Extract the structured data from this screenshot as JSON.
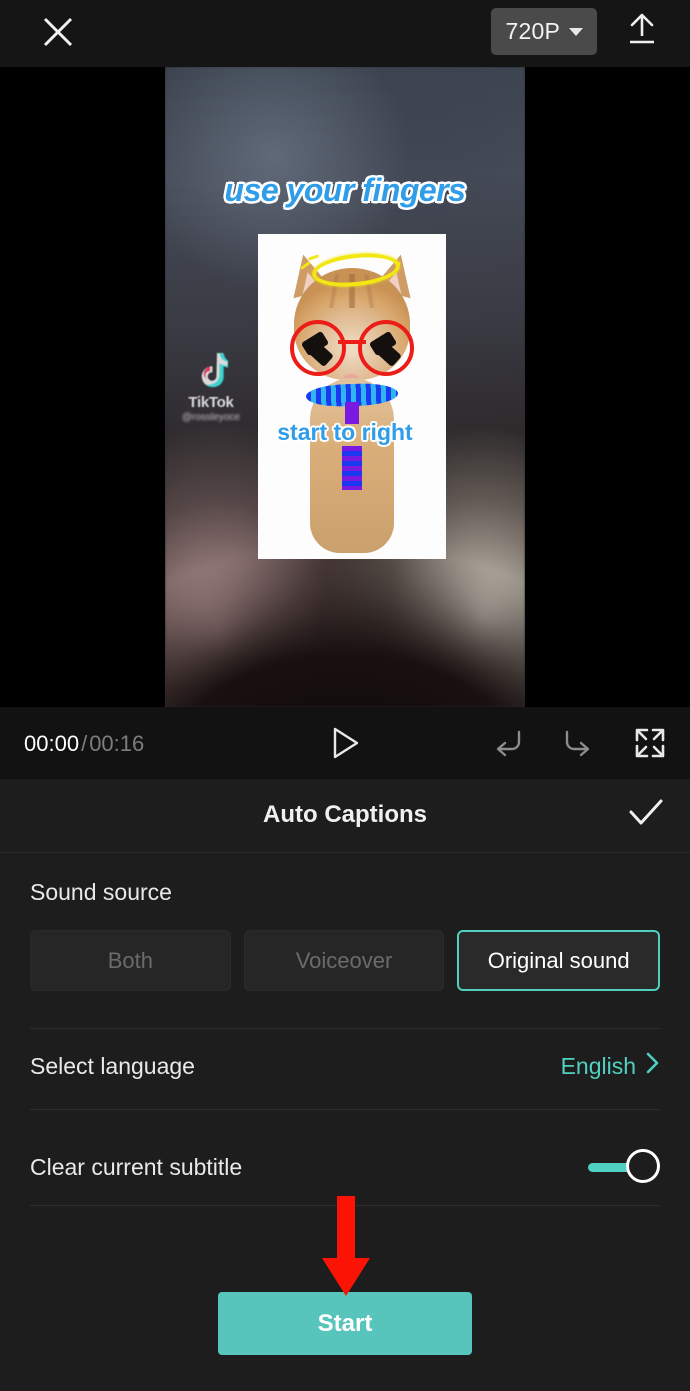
{
  "topbar": {
    "close_icon": "close-icon",
    "resolution": "720P",
    "export_icon": "export-icon"
  },
  "preview": {
    "caption_top": "use your fingers",
    "caption_mid": "start to right",
    "watermark": {
      "brand": "TikTok",
      "handle": "@rossleyoce"
    }
  },
  "playback": {
    "current_time": "00:00",
    "separator": "/",
    "total_time": "00:16",
    "play_icon": "play-icon",
    "undo_icon": "undo-icon",
    "redo_icon": "redo-icon",
    "expand_icon": "expand-icon"
  },
  "panel": {
    "title": "Auto Captions",
    "confirm_icon": "check-icon",
    "sound_source": {
      "label": "Sound source",
      "options": [
        {
          "label": "Both",
          "selected": false
        },
        {
          "label": "Voiceover",
          "selected": false
        },
        {
          "label": "Original sound",
          "selected": true
        }
      ]
    },
    "language": {
      "label": "Select language",
      "value": "English",
      "chevron_icon": "chevron-right-icon"
    },
    "clear_subtitle": {
      "label": "Clear current subtitle",
      "toggle_state": "on"
    },
    "start_button": "Start"
  },
  "annotation": {
    "arrow_icon": "down-arrow-annotation",
    "arrow_color": "#fb1405"
  },
  "colors": {
    "accent_teal": "#4fd0c0",
    "start_button": "#58c5bc",
    "panel_bg": "#1d1d1d",
    "app_bg": "#121212",
    "caption_blue": "#2f9de8"
  }
}
